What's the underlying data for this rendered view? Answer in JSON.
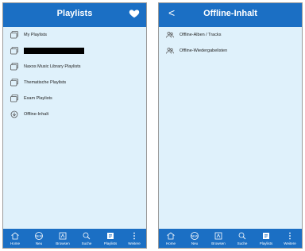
{
  "left_screen": {
    "title": "Playlists",
    "items": [
      {
        "label": "My Playlists",
        "icon": "playlist-icon"
      },
      {
        "label": "",
        "icon": "playlist-icon",
        "redacted": true
      },
      {
        "label": "Naxos Music Library Playlists",
        "icon": "playlist-icon"
      },
      {
        "label": "Thematische Playlists",
        "icon": "playlist-icon"
      },
      {
        "label": "Exam Playlists",
        "icon": "playlist-icon"
      },
      {
        "label": "Offline-Inhalt",
        "icon": "offline-download-icon"
      }
    ]
  },
  "right_screen": {
    "title": "Offline-Inhalt",
    "back_label": "<",
    "items": [
      {
        "label": "Offline-Alben / Tracks",
        "icon": "people-icon"
      },
      {
        "label": "Offline-Wiedergabelisten",
        "icon": "people-icon"
      }
    ]
  },
  "tabbar": {
    "tabs": [
      {
        "label": "Home",
        "icon": "home-icon"
      },
      {
        "label": "Neu",
        "icon": "new-icon"
      },
      {
        "label": "Browsen",
        "icon": "browse-icon"
      },
      {
        "label": "Suche",
        "icon": "search-icon"
      },
      {
        "label": "Playlists",
        "icon": "playlists-icon"
      },
      {
        "label": "Weitere",
        "icon": "more-icon"
      }
    ]
  },
  "colors": {
    "header": "#1b6fc4",
    "background": "#dff1fb",
    "text": "#222222"
  }
}
